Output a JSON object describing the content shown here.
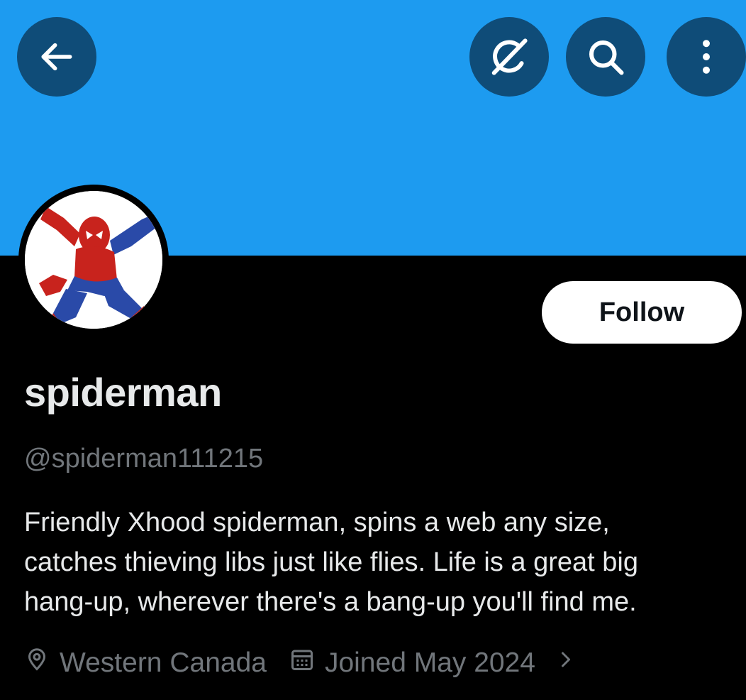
{
  "header": {
    "back_icon": "arrow-left-icon",
    "grok_icon": "grok-slash-circle-icon",
    "search_icon": "search-icon",
    "more_icon": "more-vertical-icon",
    "banner_color": "#1d9bf0"
  },
  "profile": {
    "avatar_alt": "spiderman avatar",
    "follow_label": "Follow",
    "display_name": "spiderman",
    "handle": "@spiderman111215",
    "bio": "Friendly Xhood spiderman, spins a web any size,\ncatches thieving libs just like flies.  Life is a great big\nhang-up, wherever there's a bang-up you'll find me.",
    "location": "Western Canada",
    "joined": "Joined May 2024"
  },
  "colors": {
    "accent": "#1d9bf0",
    "button_bg": "#0f4c78",
    "text_primary": "#e7e9ea",
    "text_secondary": "#71767b"
  }
}
